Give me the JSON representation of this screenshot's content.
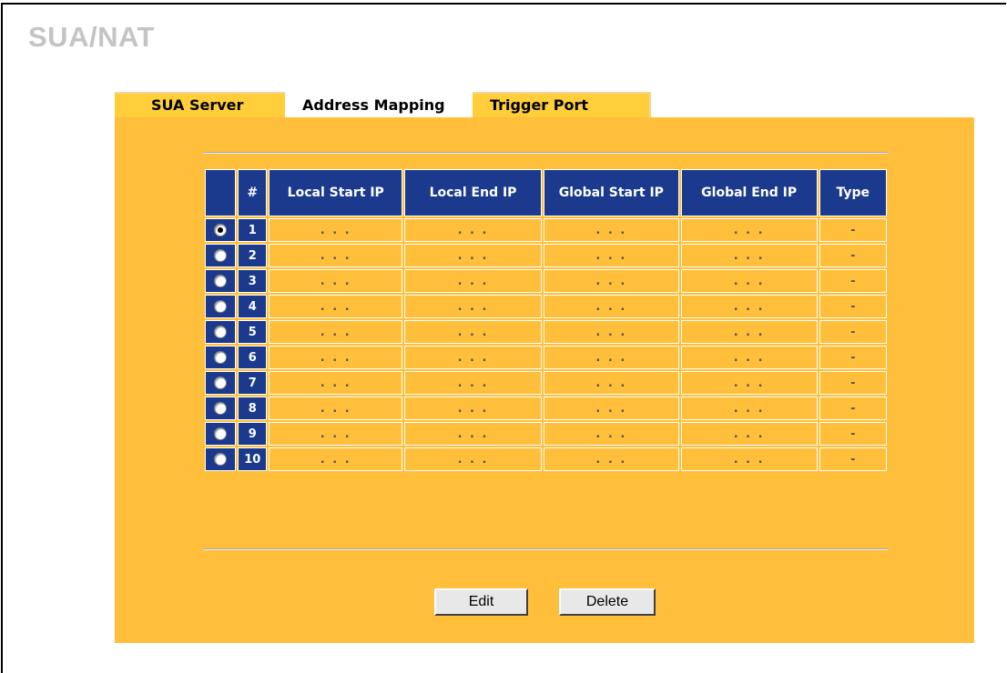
{
  "page": {
    "title": "SUA/NAT"
  },
  "tabs": [
    {
      "label": "SUA Server",
      "active": false
    },
    {
      "label": "Address Mapping",
      "active": true
    },
    {
      "label": "Trigger Port",
      "active": false
    }
  ],
  "table": {
    "headers": [
      "",
      "#",
      "Local Start IP",
      "Local End IP",
      "Global Start IP",
      "Global End IP",
      "Type"
    ],
    "rows": [
      {
        "selected": true,
        "num": "1",
        "local_start": ". . .",
        "local_end": ". . .",
        "global_start": ". . .",
        "global_end": ". . .",
        "type": "-"
      },
      {
        "selected": false,
        "num": "2",
        "local_start": ". . .",
        "local_end": ". . .",
        "global_start": ". . .",
        "global_end": ". . .",
        "type": "-"
      },
      {
        "selected": false,
        "num": "3",
        "local_start": ". . .",
        "local_end": ". . .",
        "global_start": ". . .",
        "global_end": ". . .",
        "type": "-"
      },
      {
        "selected": false,
        "num": "4",
        "local_start": ". . .",
        "local_end": ". . .",
        "global_start": ". . .",
        "global_end": ". . .",
        "type": "-"
      },
      {
        "selected": false,
        "num": "5",
        "local_start": ". . .",
        "local_end": ". . .",
        "global_start": ". . .",
        "global_end": ". . .",
        "type": "-"
      },
      {
        "selected": false,
        "num": "6",
        "local_start": ". . .",
        "local_end": ". . .",
        "global_start": ". . .",
        "global_end": ". . .",
        "type": "-"
      },
      {
        "selected": false,
        "num": "7",
        "local_start": ". . .",
        "local_end": ". . .",
        "global_start": ". . .",
        "global_end": ". . .",
        "type": "-"
      },
      {
        "selected": false,
        "num": "8",
        "local_start": ". . .",
        "local_end": ". . .",
        "global_start": ". . .",
        "global_end": ". . .",
        "type": "-"
      },
      {
        "selected": false,
        "num": "9",
        "local_start": ". . .",
        "local_end": ". . .",
        "global_start": ". . .",
        "global_end": ". . .",
        "type": "-"
      },
      {
        "selected": false,
        "num": "10",
        "local_start": ". . .",
        "local_end": ". . .",
        "global_start": ". . .",
        "global_end": ". . .",
        "type": "-"
      }
    ]
  },
  "buttons": {
    "edit": "Edit",
    "delete": "Delete"
  },
  "colors": {
    "panel": "#ffbf3a",
    "header": "#1b3a8e",
    "title": "#c4c4c4"
  }
}
